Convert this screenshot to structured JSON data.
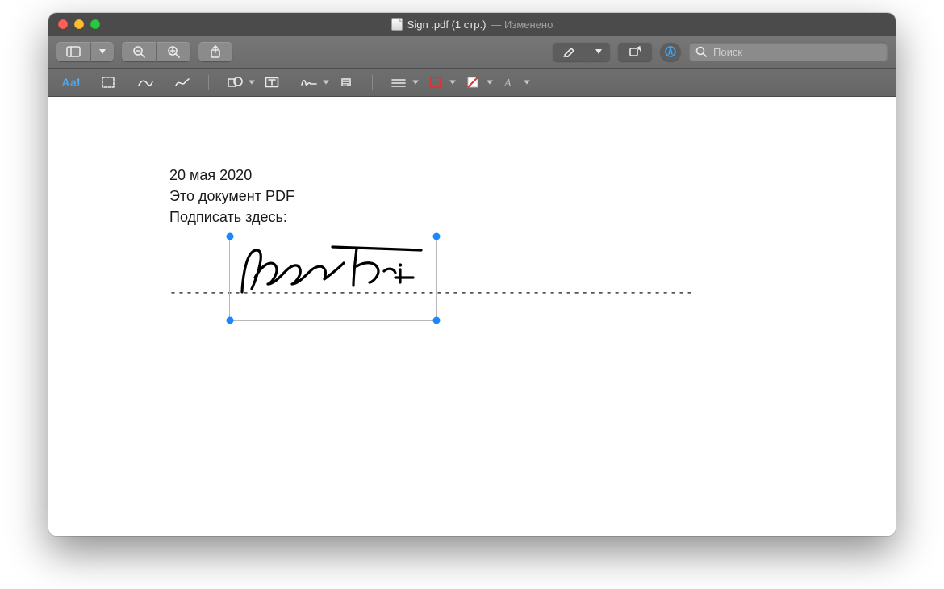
{
  "window": {
    "title_main": "Sign .pdf (1 стр.)",
    "title_sub": "— Изменено"
  },
  "toolbar": {
    "search_placeholder": "Поиск"
  },
  "markup": {
    "text_style_label": "AaI"
  },
  "document": {
    "line1": "20 мая 2020",
    "line2": "Это документ PDF",
    "line3": "Подписать здесь:",
    "dashes": "-----------------------------------------------------------------"
  }
}
